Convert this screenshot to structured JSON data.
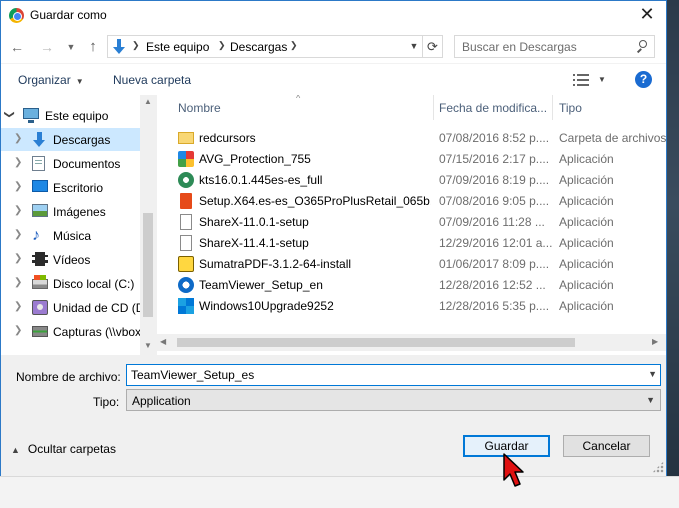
{
  "window": {
    "title": "Guardar como",
    "close_label": "✕"
  },
  "address": {
    "crumbs": [
      "Este equipo",
      "Descargas"
    ],
    "search_placeholder": "Buscar en Descargas"
  },
  "toolbar": {
    "organize_label": "Organizar",
    "new_folder_label": "Nueva carpeta",
    "help_label": "?"
  },
  "nav": {
    "items": [
      {
        "label": "Este equipo",
        "icon": "computer-icon"
      },
      {
        "label": "Descargas",
        "icon": "downloads-icon",
        "selected": true
      },
      {
        "label": "Documentos",
        "icon": "documents-icon"
      },
      {
        "label": "Escritorio",
        "icon": "desktop-icon"
      },
      {
        "label": "Imágenes",
        "icon": "pictures-icon"
      },
      {
        "label": "Música",
        "icon": "music-icon"
      },
      {
        "label": "Vídeos",
        "icon": "videos-icon"
      },
      {
        "label": "Disco local (C:)",
        "icon": "local-disk-icon"
      },
      {
        "label": "Unidad de CD (D",
        "icon": "cd-drive-icon"
      },
      {
        "label": "Capturas (\\\\vbox",
        "icon": "network-drive-icon"
      }
    ]
  },
  "files": {
    "columns": {
      "name": "Nombre",
      "date": "Fecha de modifica...",
      "type": "Tipo"
    },
    "rows": [
      {
        "name": "redcursors",
        "date": "07/08/2016 8:52 p....",
        "type": "Carpeta de archivos",
        "icon": "folder-icon"
      },
      {
        "name": "AVG_Protection_755",
        "date": "07/15/2016 2:17 p....",
        "type": "Aplicación",
        "icon": "avg-app-icon"
      },
      {
        "name": "kts16.0.1.445es-es_full",
        "date": "07/09/2016 8:19 p....",
        "type": "Aplicación",
        "icon": "kts-app-icon"
      },
      {
        "name": "Setup.X64.es-es_O365ProPlusRetail_065b...",
        "date": "07/08/2016 9:05 p....",
        "type": "Aplicación",
        "icon": "office-app-icon"
      },
      {
        "name": "ShareX-11.0.1-setup",
        "date": "07/09/2016 11:28 ...",
        "type": "Aplicación",
        "icon": "generic-app-icon"
      },
      {
        "name": "ShareX-11.4.1-setup",
        "date": "12/29/2016 12:01 a...",
        "type": "Aplicación",
        "icon": "generic-app-icon"
      },
      {
        "name": "SumatraPDF-3.1.2-64-install",
        "date": "01/06/2017 8:09 p....",
        "type": "Aplicación",
        "icon": "sumatra-app-icon"
      },
      {
        "name": "TeamViewer_Setup_en",
        "date": "12/28/2016 12:52 ...",
        "type": "Aplicación",
        "icon": "teamviewer-app-icon"
      },
      {
        "name": "Windows10Upgrade9252",
        "date": "12/28/2016 5:35 p....",
        "type": "Aplicación",
        "icon": "windows-app-icon"
      }
    ]
  },
  "form": {
    "filename_label": "Nombre de archivo:",
    "filename_value": "TeamViewer_Setup_es",
    "type_label": "Tipo:",
    "type_value": "Application",
    "hide_folders_label": "Ocultar carpetas",
    "save_label": "Guardar",
    "cancel_label": "Cancelar"
  }
}
